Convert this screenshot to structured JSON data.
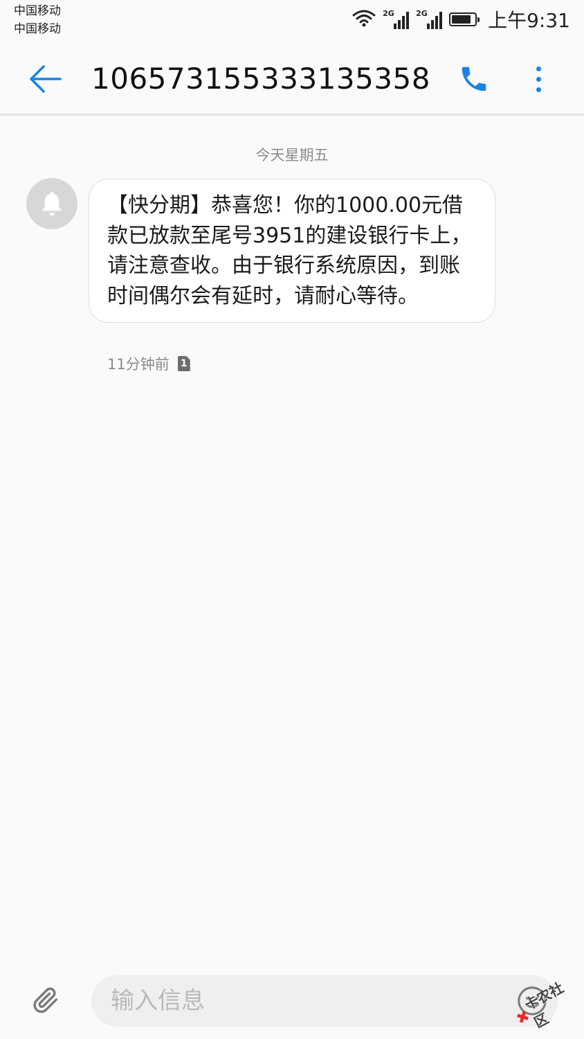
{
  "status_bar": {
    "carrier_1": "中国移动",
    "carrier_2": "中国移动",
    "network_1": "2G",
    "network_2": "2G",
    "battery_level": 0.85,
    "time": "上午9:31",
    "icons": [
      "wifi-icon",
      "signal-icon",
      "signal-icon",
      "battery-icon"
    ]
  },
  "header": {
    "title": "10657315533313535 8",
    "back_icon": "back-arrow-icon",
    "call_icon": "phone-icon",
    "more_icon": "more-vertical-icon"
  },
  "conversation": {
    "date_separator": "今天星期五",
    "messages": [
      {
        "avatar_icon": "bell-icon",
        "text": "【快分期】恭喜您！你的1000.00元借款已放款至尾号3951的建设银行卡上，请注意查收。由于银行系统原因，到账时间偶尔会有延时，请耐心等待。",
        "time": "11分钟前",
        "sim": "1"
      }
    ]
  },
  "input_bar": {
    "placeholder": "输入信息",
    "attach_icon": "paperclip-icon",
    "emoji_icon": "emoji-icon"
  },
  "watermark": {
    "text": "卡农社区"
  },
  "colors": {
    "accent": "#1a82e8",
    "background": "#fafafa",
    "bubble": "#ffffff",
    "secondary_text": "#8a8a8a"
  }
}
